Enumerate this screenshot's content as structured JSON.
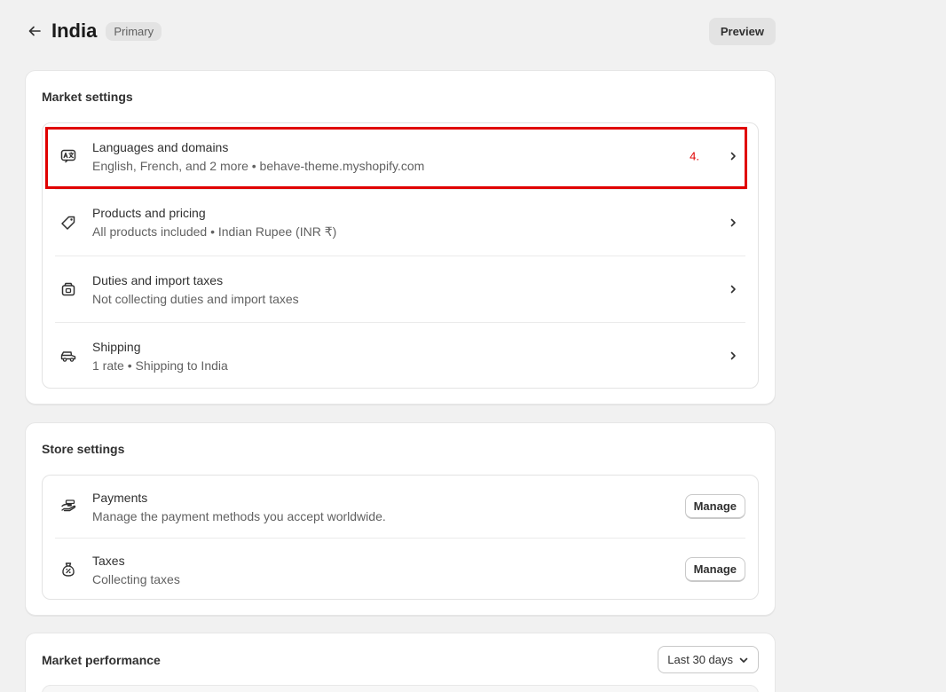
{
  "header": {
    "title": "India",
    "badge": "Primary",
    "preview_label": "Preview"
  },
  "market_settings": {
    "title": "Market settings",
    "rows": [
      {
        "icon": "translate-icon",
        "title": "Languages and domains",
        "subtitle": "English, French, and 2 more • behave-theme.myshopify.com",
        "annotation": "4."
      },
      {
        "icon": "price-tag-icon",
        "title": "Products and pricing",
        "subtitle": "All products included • Indian Rupee (INR ₹)"
      },
      {
        "icon": "package-icon",
        "title": "Duties and import taxes",
        "subtitle": "Not collecting duties and import taxes"
      },
      {
        "icon": "delivery-truck-icon",
        "title": "Shipping",
        "subtitle": "1 rate • Shipping to India"
      }
    ]
  },
  "store_settings": {
    "title": "Store settings",
    "rows": [
      {
        "icon": "payment-hand-icon",
        "title": "Payments",
        "subtitle": "Manage the payment methods you accept worldwide.",
        "button": "Manage"
      },
      {
        "icon": "tax-bag-icon",
        "title": "Taxes",
        "subtitle": "Collecting taxes",
        "button": "Manage"
      }
    ]
  },
  "market_performance": {
    "title": "Market performance",
    "range": "Last 30 days"
  },
  "colors": {
    "background": "#f1f1f1",
    "card": "#ffffff",
    "annotation_red": "#e00000"
  }
}
